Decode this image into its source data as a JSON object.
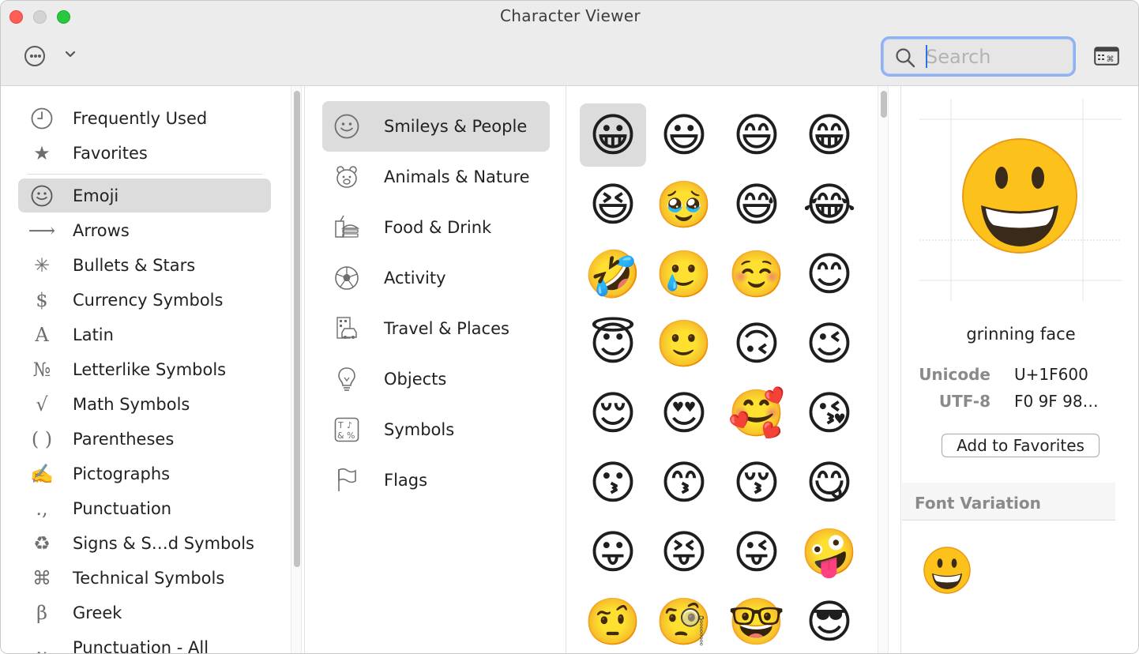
{
  "window": {
    "title": "Character Viewer"
  },
  "toolbar": {
    "more_icon": "ellipsis-circle-icon",
    "chevron_icon": "chevron-down-icon",
    "search_placeholder": "Search",
    "search_value": "",
    "keyboard_icon": "keyboard-viewer-icon"
  },
  "categories": [
    {
      "label": "Frequently Used",
      "icon": "clock-icon",
      "glyph": ""
    },
    {
      "label": "Favorites",
      "icon": "star-icon",
      "glyph": "★"
    },
    {
      "label": "Emoji",
      "icon": "smiley-icon",
      "glyph": "",
      "selected": true
    },
    {
      "label": "Arrows",
      "icon": "arrow-icon",
      "glyph": "⟶"
    },
    {
      "label": "Bullets & Stars",
      "icon": "asterisk-icon",
      "glyph": "✳"
    },
    {
      "label": "Currency Symbols",
      "icon": "dollar-icon",
      "glyph": "$"
    },
    {
      "label": "Latin",
      "icon": "latin-a-icon",
      "glyph": "A"
    },
    {
      "label": "Letterlike Symbols",
      "icon": "numero-icon",
      "glyph": "№"
    },
    {
      "label": "Math Symbols",
      "icon": "square-root-icon",
      "glyph": "√"
    },
    {
      "label": "Parentheses",
      "icon": "parentheses-icon",
      "glyph": "( )"
    },
    {
      "label": "Pictographs",
      "icon": "writing-hand-icon",
      "glyph": "✍"
    },
    {
      "label": "Punctuation",
      "icon": "punctuation-icon",
      "glyph": ".,"
    },
    {
      "label": "Signs & S…d Symbols",
      "icon": "recycle-icon",
      "glyph": "♻"
    },
    {
      "label": "Technical Symbols",
      "icon": "command-icon",
      "glyph": "⌘"
    },
    {
      "label": "Greek",
      "icon": "beta-icon",
      "glyph": "β"
    },
    {
      "label": "Punctuation - All",
      "icon": "punctuation-all-icon",
      "glyph": ".,"
    }
  ],
  "subcategories": [
    {
      "label": "Smileys & People",
      "icon": "smiley-icon",
      "selected": true
    },
    {
      "label": "Animals & Nature",
      "icon": "bear-icon"
    },
    {
      "label": "Food & Drink",
      "icon": "burger-icon"
    },
    {
      "label": "Activity",
      "icon": "soccer-ball-icon"
    },
    {
      "label": "Travel & Places",
      "icon": "car-building-icon"
    },
    {
      "label": "Objects",
      "icon": "lightbulb-icon"
    },
    {
      "label": "Symbols",
      "icon": "symbols-icon"
    },
    {
      "label": "Flags",
      "icon": "flag-icon"
    }
  ],
  "emoji_rows": [
    [
      "😀",
      "😃",
      "😄",
      "😁"
    ],
    [
      "😆",
      "🥹",
      "😅",
      "😂"
    ],
    [
      "🤣",
      "🥲",
      "☺️",
      "😊"
    ],
    [
      "😇",
      "🙂",
      "🙃",
      "😉"
    ],
    [
      "😌",
      "😍",
      "🥰",
      "😘"
    ],
    [
      "😗",
      "😙",
      "😚",
      "😋"
    ],
    [
      "😛",
      "😝",
      "😜",
      "🤪"
    ],
    [
      "🤨",
      "🧐",
      "🤓",
      "😎"
    ]
  ],
  "detail": {
    "glyph": "😀",
    "name": "grinning face",
    "unicode_label": "Unicode",
    "unicode_value": "U+1F600",
    "utf8_label": "UTF-8",
    "utf8_value": "F0 9F 98…",
    "favorites_button": "Add to Favorites",
    "font_variation_label": "Font Variation",
    "variants": [
      "😀"
    ]
  },
  "colors": {
    "selection": "#dcdcdc",
    "search_focus": "#8fb2f3",
    "emoji_face": "#fcc21b",
    "emoji_outline": "#e0901a",
    "icon_gray": "#6e6e6e"
  }
}
